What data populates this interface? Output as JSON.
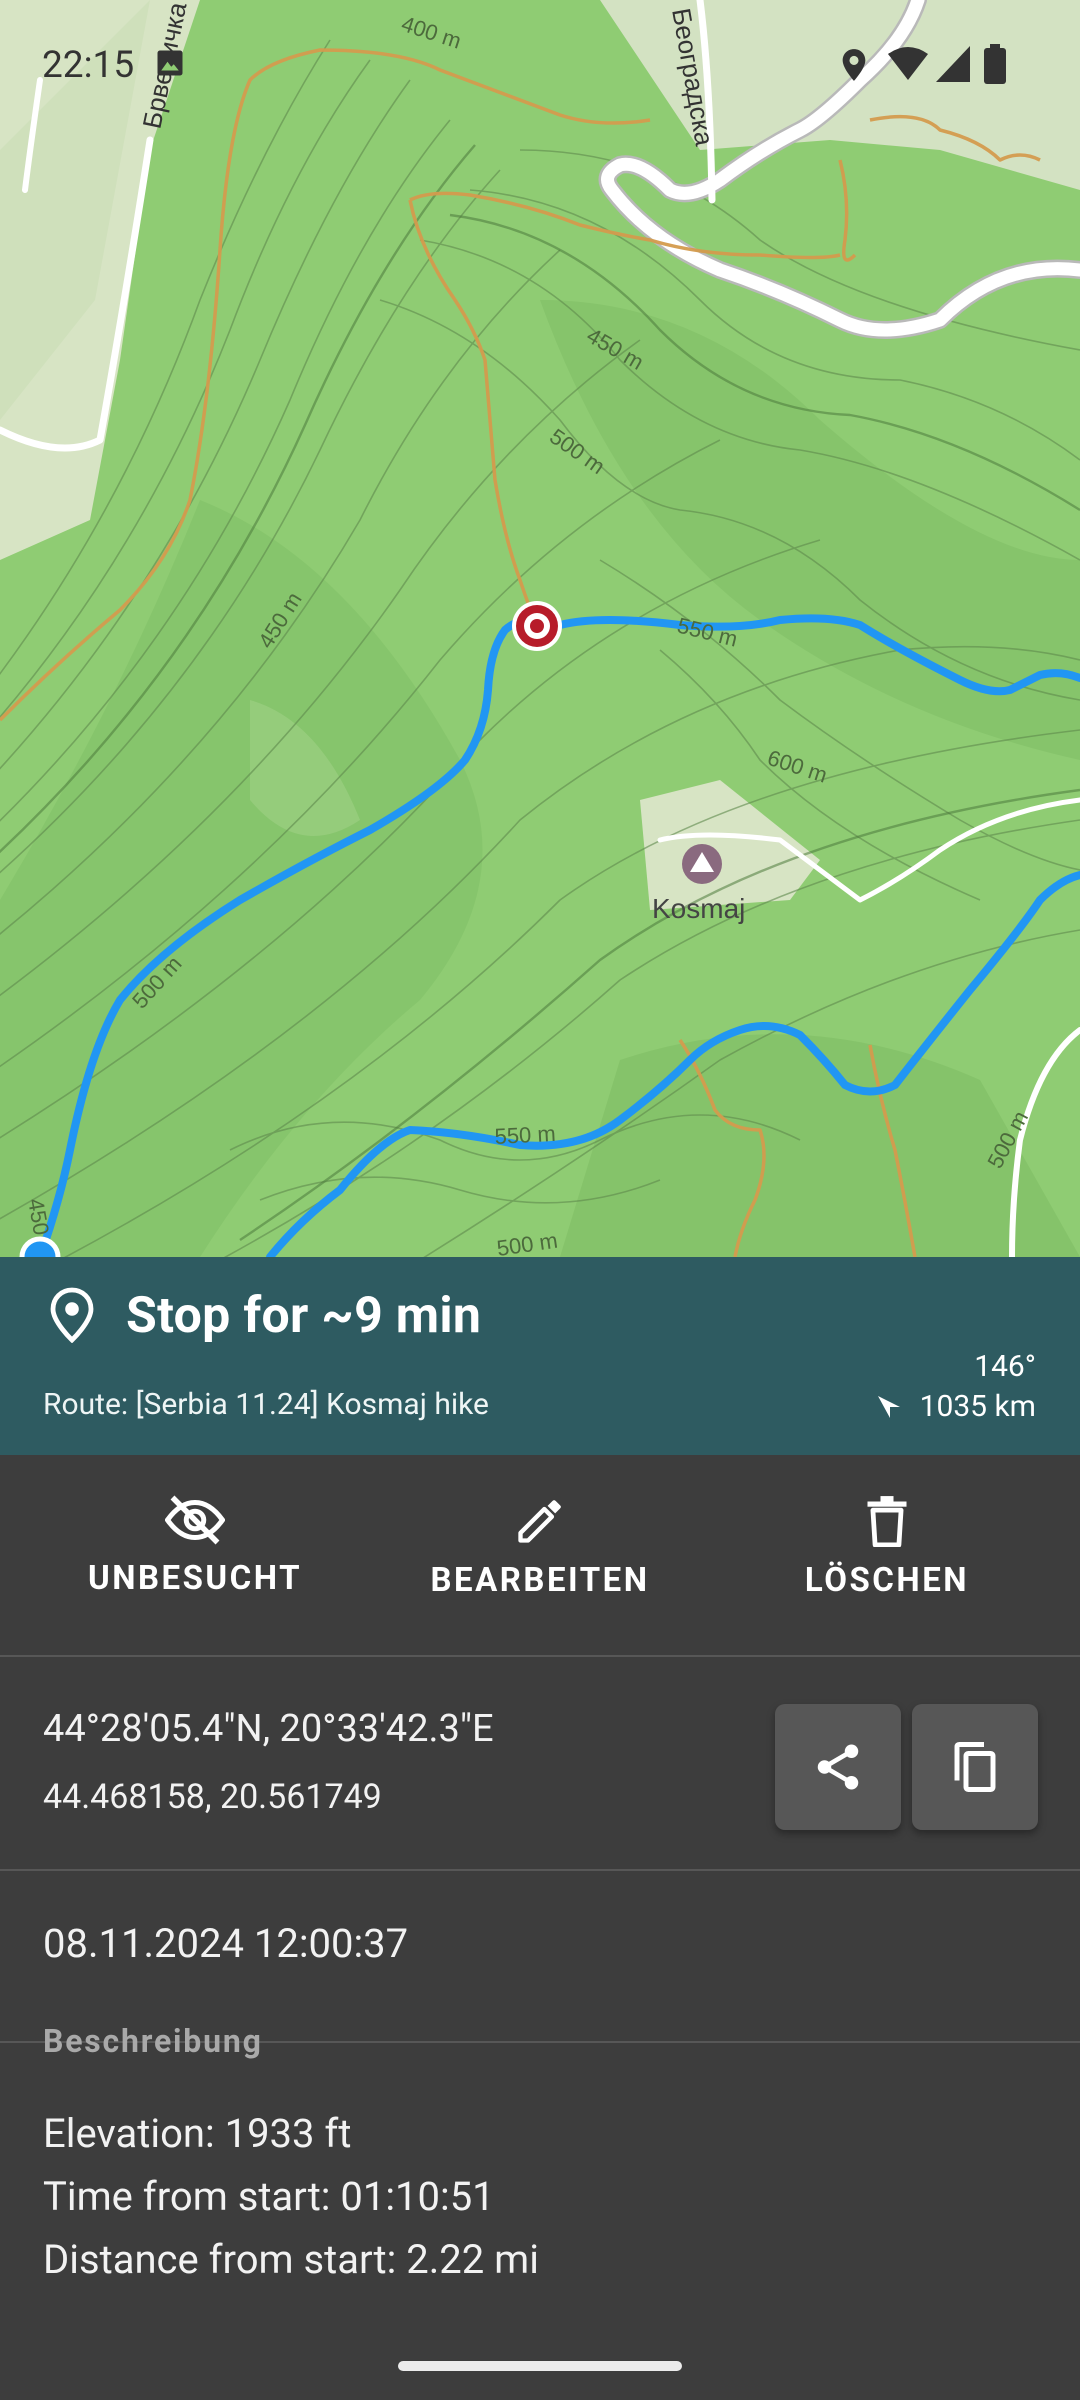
{
  "status_bar": {
    "time": "22:15",
    "icons": [
      "image-icon",
      "location-icon",
      "wifi-icon",
      "signal-icon",
      "battery-icon"
    ]
  },
  "map": {
    "labels": {
      "street_left": "Брвеничка",
      "street_top": "Београдска",
      "c400": "400 m",
      "c450a": "450 m",
      "c500a": "500 m",
      "c450b": "450 m",
      "c550a": "550 m",
      "c600": "600 m",
      "c500b": "500 m",
      "c550b": "550 m",
      "c500c": "500 m",
      "c500d": "500 m",
      "c450c": "450",
      "peak": "Kosmaj"
    },
    "colors": {
      "route": "#2196f3",
      "pin": "#b71c2a",
      "path": "#e9b36a",
      "road": "#ffffff"
    }
  },
  "point": {
    "title": "Stop for ~9 min",
    "route": "Route: [Serbia 11.24] Kosmaj hike",
    "bearing": "146°",
    "distance": "1035 km"
  },
  "actions": {
    "unvisited": "UNBESUCHT",
    "edit": "BEARBEITEN",
    "delete": "LÖSCHEN"
  },
  "coordinates": {
    "dms": "44°28'05.4\"N, 20°33'42.3\"E",
    "decimal": "44.468158, 20.561749"
  },
  "date": "08.11.2024 12:00:37",
  "description": {
    "label": "Beschreibung",
    "lines": [
      "Elevation: 1933 ft",
      "Time from start: 01:10:51",
      "Distance from start: 2.22 mi"
    ]
  },
  "theme": {
    "header_bg": "#2e5b61",
    "panel_bg": "#3d3d3d",
    "button_bg": "#575757"
  }
}
